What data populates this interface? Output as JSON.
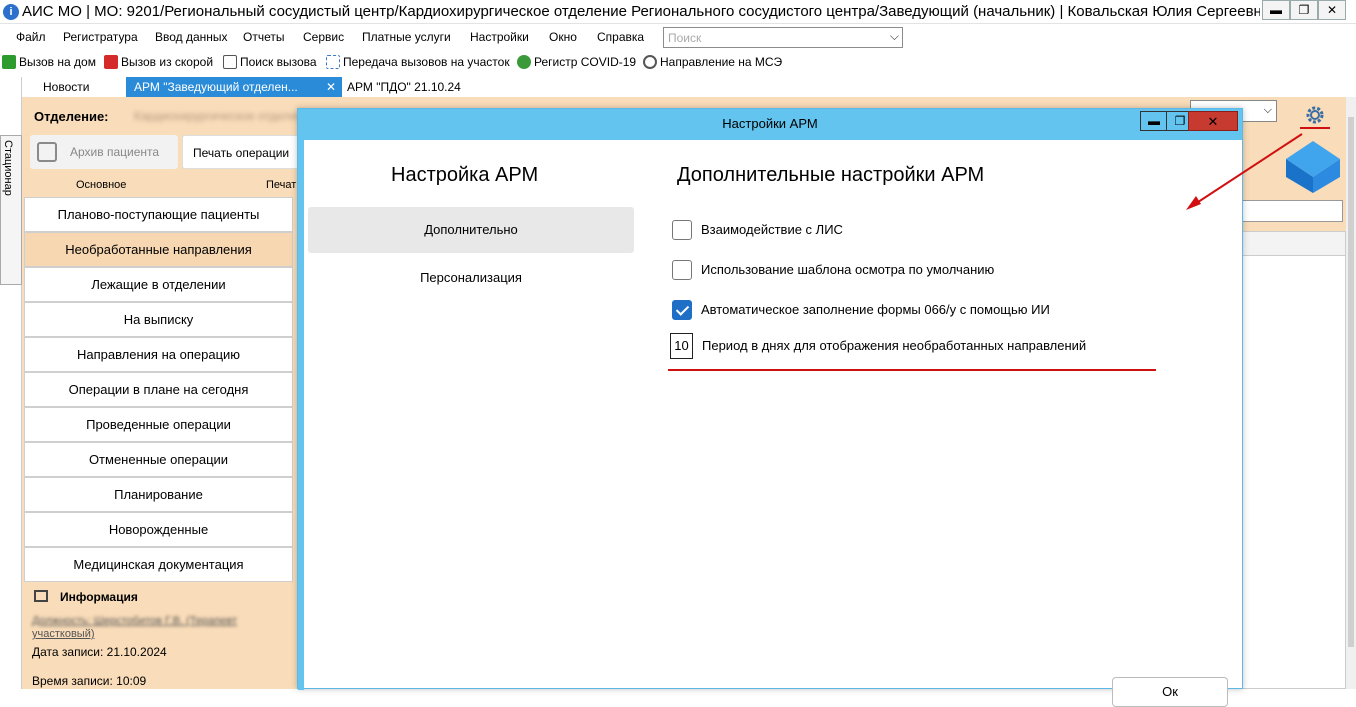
{
  "window": {
    "title": "АИС МО | МО: 9201/Региональный сосудистый центр/Кардиохирургическое отделение Регионального сосудистого центра/Заведующий (начальник) | Ковальская Юлия Сергеевна",
    "min_label": "▬",
    "max_label": "❐",
    "close_label": "✕"
  },
  "menu": {
    "items": [
      "Файл",
      "Регистратура",
      "Ввод данных",
      "Отчеты",
      "Сервис",
      "Платные услуги",
      "Настройки",
      "Окно",
      "Справка"
    ],
    "search_placeholder": "Поиск"
  },
  "toolbar": {
    "items": [
      {
        "label": "Вызов на дом",
        "icon": "check-green-icon",
        "color": "#2e9b2e"
      },
      {
        "label": "Вызов из скорой",
        "icon": "check-red-icon",
        "color": "#d42a2a"
      },
      {
        "label": "Поиск вызова",
        "icon": "search-doc-icon",
        "color": "#555555"
      },
      {
        "label": "Передача вызовов на участок",
        "icon": "transfer-icon",
        "color": "#3a7bc8"
      },
      {
        "label": "Регистр COVID-19",
        "icon": "virus-icon",
        "color": "#3a9a3a"
      },
      {
        "label": "Направление на МСЭ",
        "icon": "refresh-icon",
        "color": "#555555"
      }
    ]
  },
  "tabs": [
    {
      "label": "Новости"
    },
    {
      "label": "АРМ \"Заведующий отделен...",
      "close": "✕"
    },
    {
      "label": "АРМ \"ПДО\" 21.10.24"
    }
  ],
  "side_tab": {
    "label": "Стационар"
  },
  "workspace": {
    "department_label": "Отделение:",
    "department_value": "Кардиохирургическое отделение",
    "archive_button": "Архив пациента",
    "print_button": "Печать операции",
    "section_main": "Основное",
    "section_print": "Печать",
    "nav": [
      "Планово-поступающие пациенты",
      "Необработанные направления",
      "Лежащие в отделении",
      "На выписку",
      "Направления на операцию",
      "Операции в плане на сегодня",
      "Проведенные операции",
      "Отмененные операции",
      "Планирование",
      "Новорожденные",
      "Медицинская документация"
    ],
    "nav_selected_index": 1,
    "info": {
      "title": "Информация",
      "author_line1": "Должность: Шерстобитов Г.В. (Терапевт",
      "author_line2": "участковый)",
      "date": "Дата записи: 21.10.2024",
      "time": "Время записи: 10:09"
    }
  },
  "dialog": {
    "title": "Настройки АРМ",
    "min_label": "▬",
    "max_label": "❐",
    "close_label": "✕",
    "side_title": "Настройка АРМ",
    "side_items": [
      "Дополнительно",
      "Персонализация"
    ],
    "active_side_index": 0,
    "heading": "Дополнительные настройки АРМ",
    "options": [
      {
        "label": "Взаимодействие с ЛИС",
        "checked": false
      },
      {
        "label": "Использование шаблона осмотра по умолчанию",
        "checked": false
      },
      {
        "label": "Автоматическое заполнение формы 066/у с помощью ИИ",
        "checked": true
      }
    ],
    "period_value": "10",
    "period_label": "Период в днях для отображения необработанных направлений",
    "ok_label": "Ок"
  },
  "colors": {
    "accent": "#2a8bd8",
    "dialog_title": "#62c4ef",
    "workspace_bg": "#f9dcb9",
    "annotation_red": "#d01010"
  }
}
